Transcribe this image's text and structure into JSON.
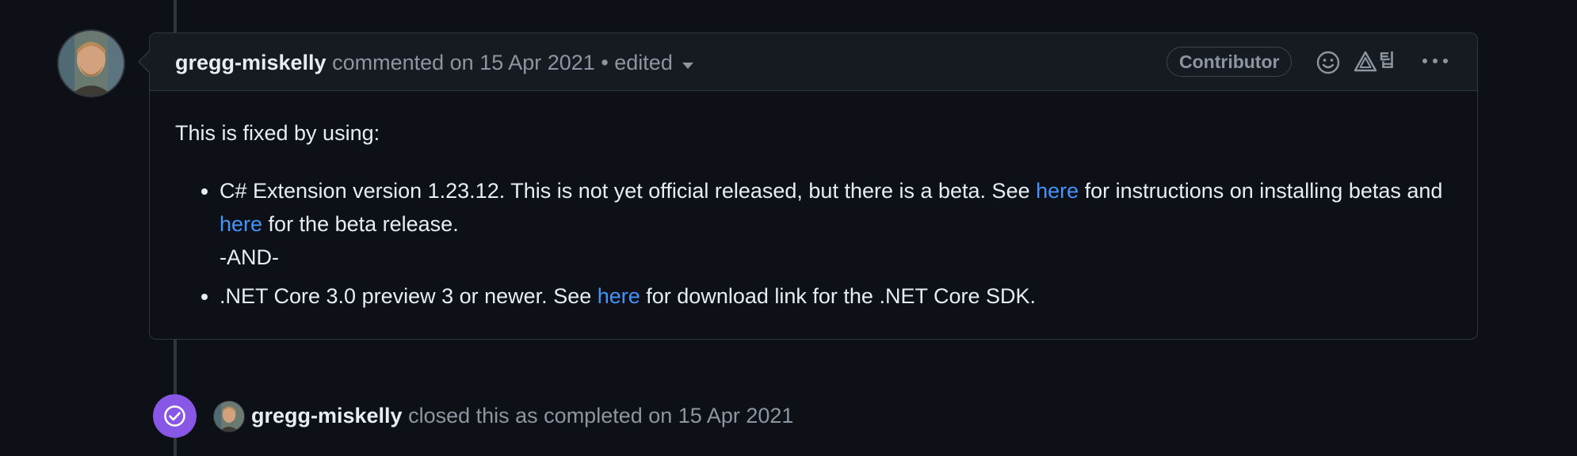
{
  "comment": {
    "author": "gregg-miskelly",
    "meta": "commented on 15 Apr 2021 • edited",
    "badge": "Contributor",
    "tip_label": "팁",
    "intro": "This is fixed by using:",
    "item1": {
      "text_a": "C# Extension version 1.23.12. This is not yet official released, but there is a beta. See ",
      "link_a": "here",
      "text_b": " for instructions on installing betas and ",
      "link_b": "here",
      "text_c": " for the beta release.",
      "and_text": "-AND-"
    },
    "item2": {
      "text_a": ".NET Core 3.0 preview 3 or newer. See ",
      "link_a": "here",
      "text_b": " for download link for the .NET Core SDK."
    }
  },
  "event": {
    "actor": "gregg-miskelly",
    "action": "closed this as completed on 15 Apr 2021"
  },
  "colors": {
    "background": "#0d1117",
    "header_bg": "#161b22",
    "border": "#30363d",
    "link": "#4493f8",
    "closed_badge": "#8957e5",
    "muted_text": "#8d96a0"
  },
  "icons": [
    "smiley-icon",
    "alert-icon",
    "kebab-icon",
    "check-circle-icon",
    "caret-down-icon"
  ]
}
